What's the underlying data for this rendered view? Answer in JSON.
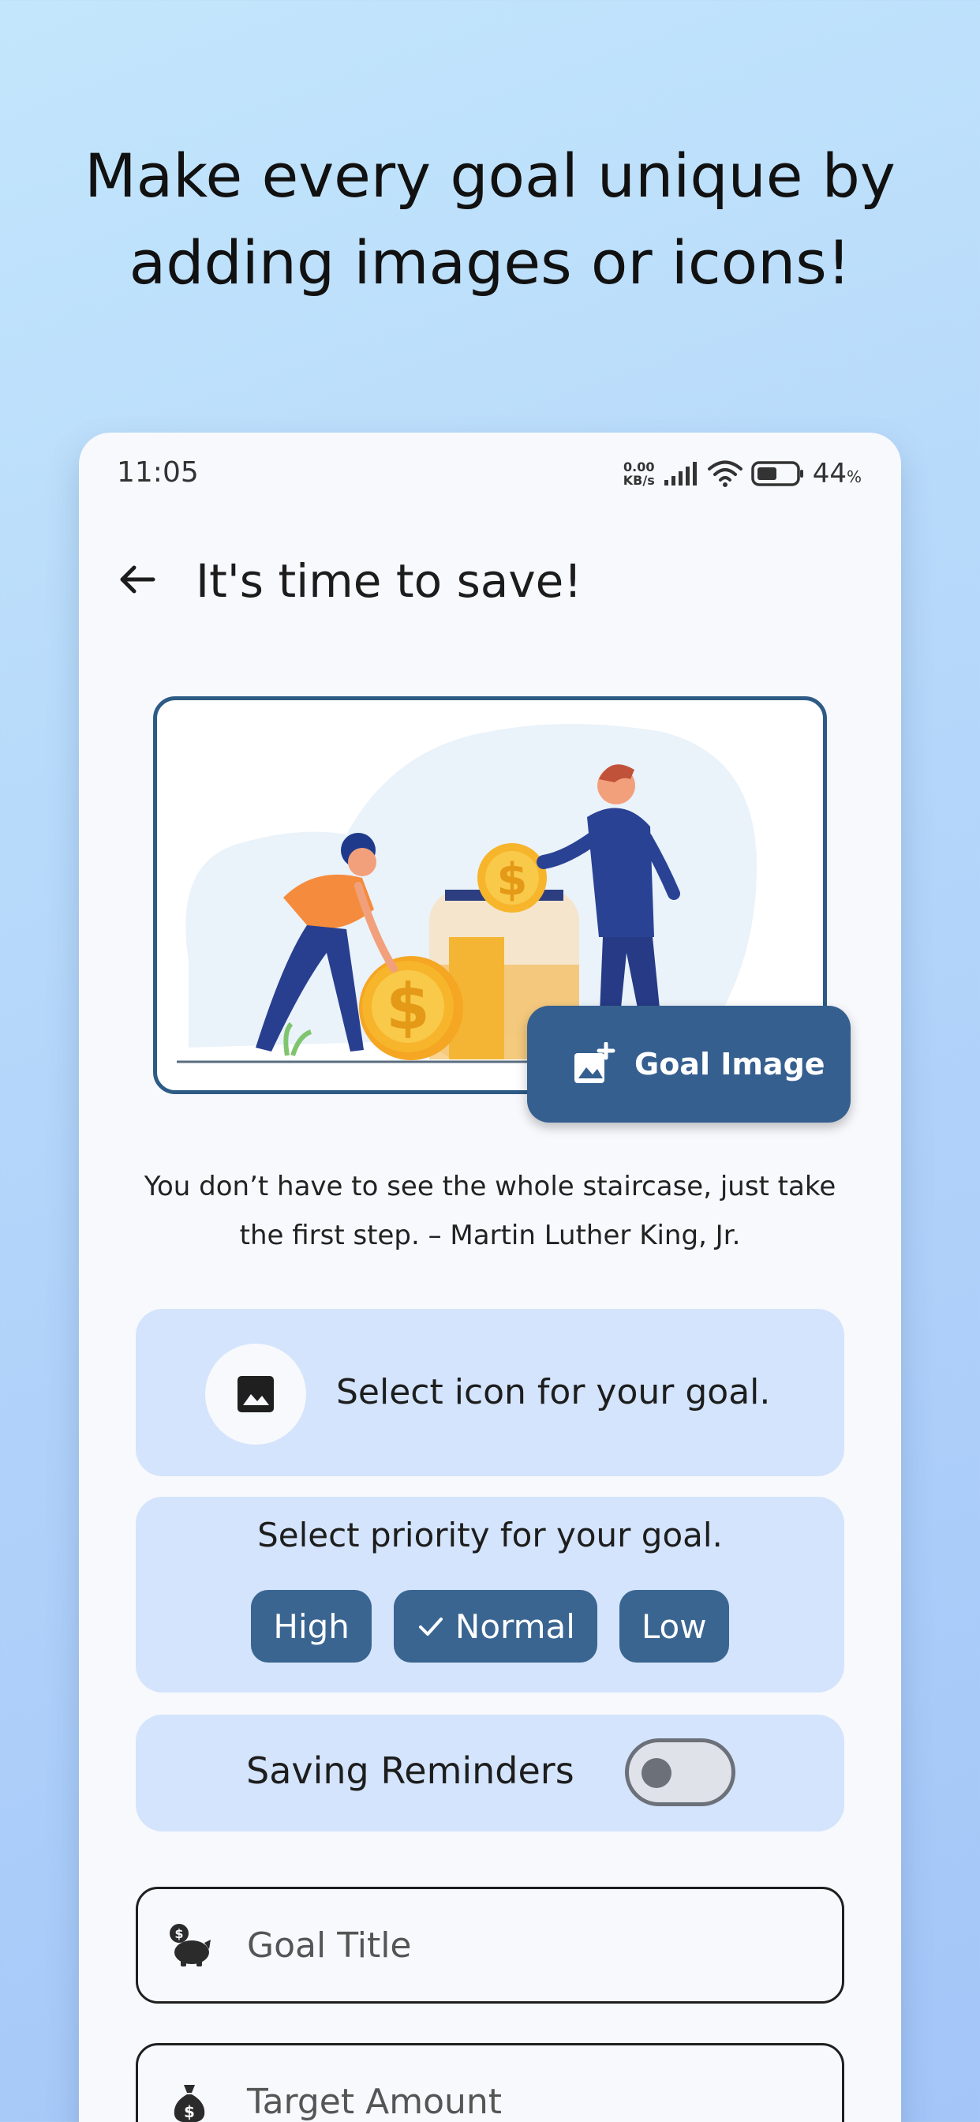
{
  "headline": "Make every goal unique by adding images or icons!",
  "status_bar": {
    "time": "11:05",
    "net_speed_value": "0.00",
    "net_speed_unit": "KB/s",
    "battery": "44",
    "battery_unit": "%"
  },
  "app_bar": {
    "title": "It's time to save!",
    "back_icon": "arrow-back-icon"
  },
  "goal_image_button": {
    "label": "Goal Image",
    "icon": "add-photo-icon"
  },
  "quote": "You don’t have to see the whole staircase, just take the first step. – Martin Luther King, Jr.",
  "icon_selector": {
    "label": "Select icon for your goal.",
    "icon": "image-icon"
  },
  "priority": {
    "label": "Select priority for your goal.",
    "options": [
      {
        "label": "High",
        "selected": false
      },
      {
        "label": "Normal",
        "selected": true
      },
      {
        "label": "Low",
        "selected": false
      }
    ]
  },
  "reminders": {
    "label": "Saving Reminders",
    "enabled": false
  },
  "fields": {
    "goal_title": {
      "placeholder": "Goal Title",
      "icon": "piggy-bank-icon"
    },
    "target_amount": {
      "placeholder": "Target Amount",
      "icon": "money-bag-icon"
    }
  },
  "colors": {
    "primary": "#355f8f",
    "card_bg": "#d3e4fc",
    "surface": "#f8f9fd",
    "frame_border": "#2d5b86"
  }
}
